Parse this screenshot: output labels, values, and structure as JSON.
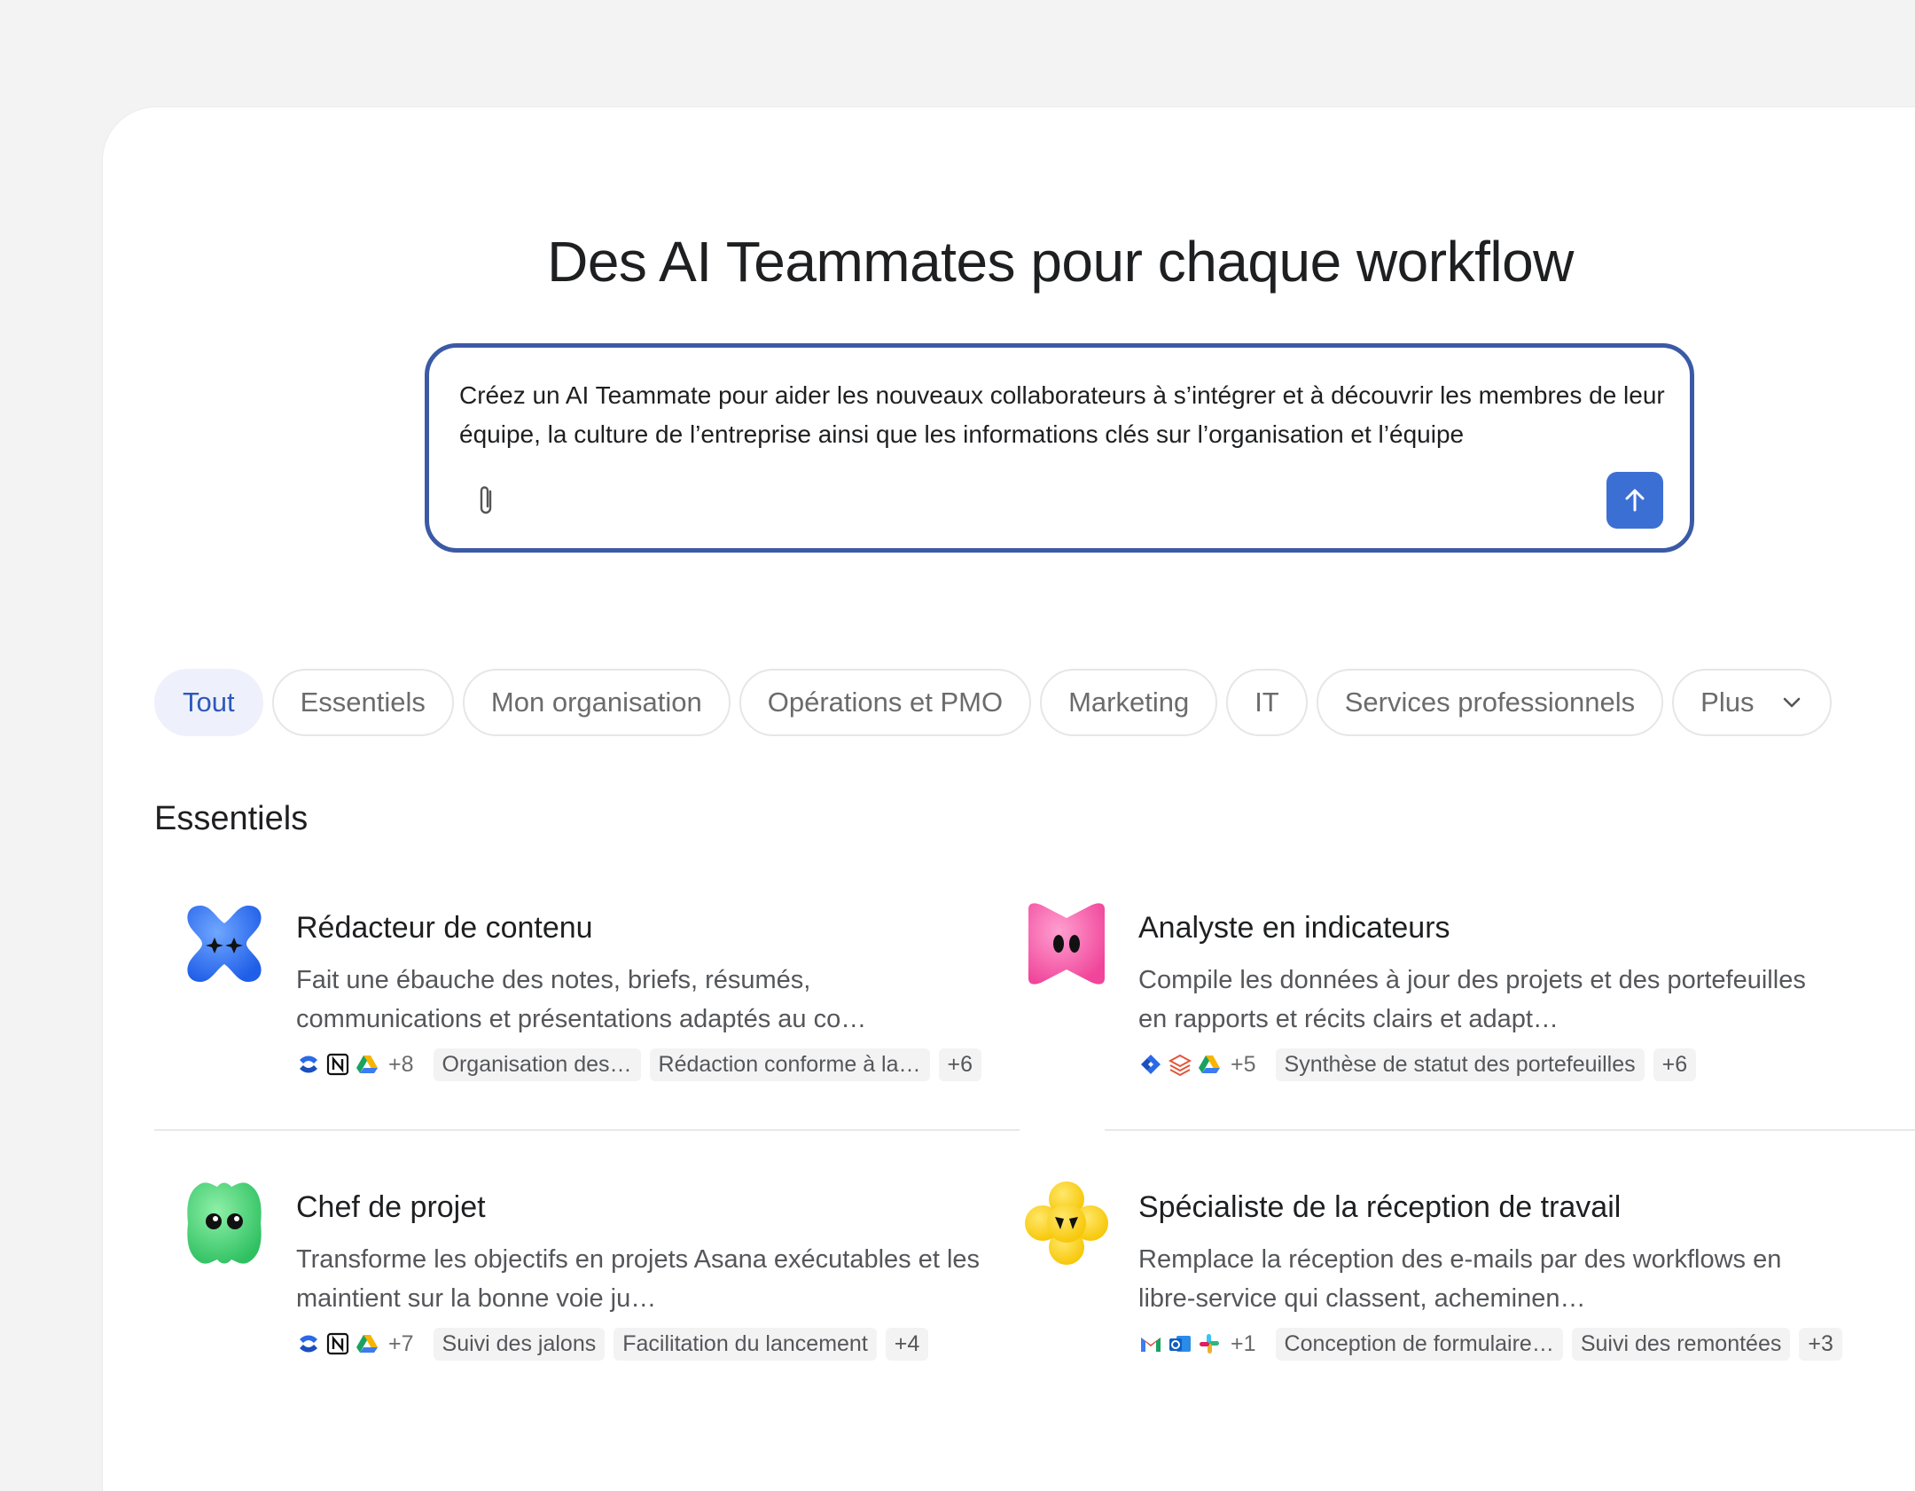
{
  "headline": "Des AI Teammates pour chaque workflow",
  "prompt": {
    "text": "Créez un AI Teammate pour aider les nouveaux collaborateurs à s’intégrer et à découvrir les membres de leur équipe, la culture de l’entreprise ainsi que les informations clés sur l’organisation et l’équipe",
    "attach_icon": "paperclip-icon",
    "send_icon": "arrow-up-icon",
    "accent_color": "#3b5aa6",
    "send_color": "#3b6fd4"
  },
  "tabs": [
    {
      "label": "Tout",
      "active": true
    },
    {
      "label": "Essentiels"
    },
    {
      "label": "Mon organisation"
    },
    {
      "label": "Opérations et PMO"
    },
    {
      "label": "Marketing"
    },
    {
      "label": "IT"
    },
    {
      "label": "Services professionnels"
    },
    {
      "label": "Plus",
      "icon": "chevron-down-icon"
    }
  ],
  "section_title": "Essentiels",
  "cards": [
    {
      "title": "Rédacteur de contenu",
      "desc": "Fait une ébauche des notes, briefs, résumés, communications et présentations adaptés au co…",
      "avatar": "blue-sparkle-avatar",
      "apps": [
        "confluence-icon",
        "notion-icon",
        "google-drive-icon"
      ],
      "more_apps": "+8",
      "tags": [
        "Organisation des…",
        "Rédaction conforme à la…"
      ],
      "more_tags": "+6"
    },
    {
      "title": "Analyste en indicateurs",
      "desc": "Compile les données à jour des projets et des portefeuilles en rapports et récits clairs et adapt…",
      "avatar": "pink-bow-avatar",
      "apps": [
        "jira-icon",
        "stack-icon",
        "google-drive-icon"
      ],
      "more_apps": "+5",
      "tags": [
        "Synthèse de statut des portefeuilles"
      ],
      "more_tags": "+6"
    },
    {
      "title": "Chef de projet",
      "desc": "Transforme les objectifs en projets Asana exécutables et les maintient sur la bonne voie ju…",
      "avatar": "green-blob-avatar",
      "apps": [
        "confluence-icon",
        "notion-icon",
        "google-drive-icon"
      ],
      "more_apps": "+7",
      "tags": [
        "Suivi des jalons",
        "Facilitation du lancement"
      ],
      "more_tags": "+4"
    },
    {
      "title": "Spécialiste de la réception de travail",
      "desc": "Remplace la réception des e-mails par des workflows en libre-service qui classent, acheminen…",
      "avatar": "yellow-flower-avatar",
      "apps": [
        "gmail-icon",
        "outlook-icon",
        "slack-icon"
      ],
      "more_apps": "+1",
      "tags": [
        "Conception de formulaire…",
        "Suivi des remontées"
      ],
      "more_tags": "+3"
    }
  ]
}
